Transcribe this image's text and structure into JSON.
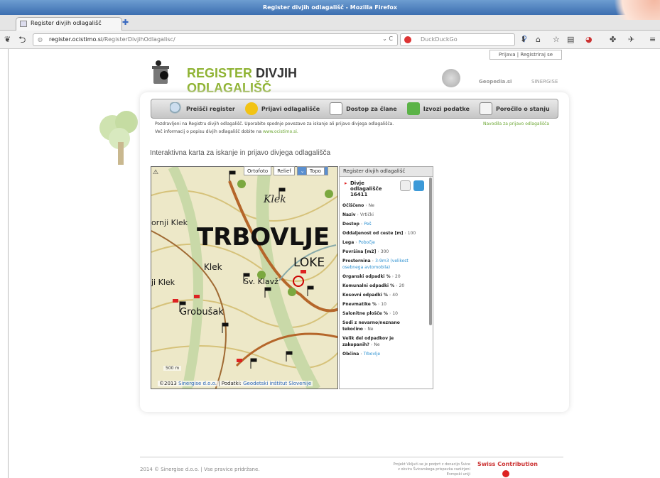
{
  "window": {
    "title": "Register divjih odlagališč - Mozilla Firefox"
  },
  "tab": {
    "title": "Register divjih odlagališč"
  },
  "nav": {
    "url_host": "register.ocistimo.si",
    "url_path": "/RegisterDivjihOdlagalisc/",
    "search_placeholder": "DuckDuckGo"
  },
  "auth": {
    "label": "Prijava | Registriraj se"
  },
  "logo": {
    "word1": "REGISTER",
    "word2": "DIVJIH",
    "word3": "ODLAGALIŠČ"
  },
  "partners": {
    "p1": "Geopedia.si",
    "p2": "SINERGISE"
  },
  "menu": {
    "items": [
      "Preišči register",
      "Prijavi odlagališče",
      "Dostop za člane",
      "Izvozi podatke",
      "Poročilo o stanju"
    ]
  },
  "welcome": {
    "line1": "Pozdravljeni na Registru divjih odlagališč. Uporabite spodnje povezave za iskanje ali prijavo divjega odlagališča.",
    "line2_prefix": "Več informacij o popisu divjih odlagališč dobite na",
    "line2_link": "www.ocistimo.si.",
    "help": "Navodila za prijavo odlagališča"
  },
  "map": {
    "heading": "Interaktivna karta za iskanje in prijavo divjega odlagališča",
    "layers": [
      "Ortofoto",
      "Relief",
      "Topo"
    ],
    "place_big": "TRBOVLJE",
    "place_loke": "LOKE",
    "place_klek": "Klek",
    "place_klek2": "ji Klek",
    "place_grob": "Grobušak",
    "place_klavz": "Sv. Klavž",
    "scale": "500 m",
    "attribution_prefix": "©2013",
    "attribution_link1": "Sinergise d.o.o.",
    "attribution_mid": "| Podatki:",
    "attribution_link2": "Geodetski inštitut Slovenije"
  },
  "panel": {
    "header": "Register divjih odlagališč",
    "title_line1": "Divje",
    "title_line2": "odlagališče",
    "title_line3": "16411",
    "fields": [
      {
        "k": "Očiščeno",
        "v": "Ne",
        "link": false
      },
      {
        "k": "Naziv",
        "v": "Vrtički",
        "link": false
      },
      {
        "k": "Dostop",
        "v": "Peš",
        "link": true
      },
      {
        "k": "Oddaljenost od ceste [m]",
        "v": "100",
        "link": false
      },
      {
        "k": "Lega",
        "v": "Pobočje",
        "link": true
      },
      {
        "k": "Površina [m2]",
        "v": "300",
        "link": false
      },
      {
        "k": "Prostornina",
        "v": "3-9m3 (velikost osebnega avtomobila)",
        "link": true
      },
      {
        "k": "Organski odpadki %",
        "v": "20",
        "link": false
      },
      {
        "k": "Komunalni odpadki %",
        "v": "20",
        "link": false
      },
      {
        "k": "Kosovni odpadki %",
        "v": "40",
        "link": false
      },
      {
        "k": "Pnevmatike %",
        "v": "10",
        "link": false
      },
      {
        "k": "Salonitne plošče %",
        "v": "10",
        "link": false
      },
      {
        "k": "Sodi z nevarno/neznano tekočino",
        "v": "Ne",
        "link": false
      },
      {
        "k": "Velik del odpadkov je zakopanih?",
        "v": "Ne",
        "link": false
      },
      {
        "k": "Občina",
        "v": "Trbovlje",
        "link": true
      }
    ]
  },
  "footer": {
    "copyright": "2014 © Sinergise d.o.o. | Vse pravice pridržane.",
    "project": "Projekt Vključi.se je podprt z donacijo Švice v okviru Švicarskega prispevka razširjeni Evropski uniji",
    "swiss": "Swiss Contribution"
  }
}
